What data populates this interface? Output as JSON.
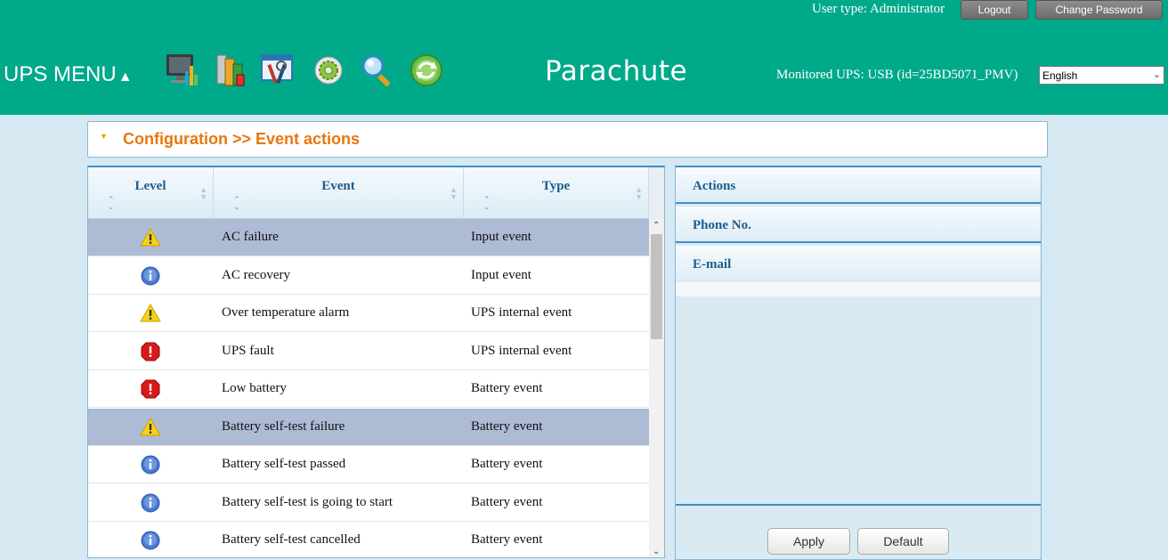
{
  "header": {
    "user_type": "User type: Administrator",
    "logout_label": "Logout",
    "change_password_label": "Change Password",
    "menu_label": "UPS MENU",
    "menu_caret": "▲",
    "brand": "Parachute",
    "monitored_ups": "Monitored UPS: USB (id=25BD5071_PMV)",
    "language": "English",
    "nav_icons": [
      "status-monitor-icon",
      "battery-data-icon",
      "configuration-tools-icon",
      "settings-gear-icon",
      "search-magnifier-icon",
      "refresh-icon"
    ]
  },
  "breadcrumb": {
    "title": "Configuration >> Event actions"
  },
  "table": {
    "columns": [
      "Level",
      "Event",
      "Type"
    ],
    "rows": [
      {
        "level": "warning",
        "event": "AC failure",
        "type": "Input event",
        "selected": true
      },
      {
        "level": "info",
        "event": "AC recovery",
        "type": "Input event",
        "selected": false
      },
      {
        "level": "warning",
        "event": "Over temperature alarm",
        "type": "UPS internal event",
        "selected": false
      },
      {
        "level": "error",
        "event": "UPS fault",
        "type": "UPS internal event",
        "selected": false
      },
      {
        "level": "error",
        "event": "Low battery",
        "type": "Battery event",
        "selected": false
      },
      {
        "level": "warning",
        "event": "Battery self-test failure",
        "type": "Battery event",
        "selected": true
      },
      {
        "level": "info",
        "event": "Battery self-test passed",
        "type": "Battery event",
        "selected": false
      },
      {
        "level": "info",
        "event": "Battery self-test is going to start",
        "type": "Battery event",
        "selected": false
      },
      {
        "level": "info",
        "event": "Battery self-test cancelled",
        "type": "Battery event",
        "selected": false
      }
    ]
  },
  "right_panel": {
    "sections": [
      "Actions",
      "Phone No.",
      "E-mail"
    ],
    "apply_label": "Apply",
    "default_label": "Default"
  },
  "colors": {
    "header_bg": "#00a98a",
    "page_bg": "#d6e9f2",
    "breadcrumb_text": "#e8760e",
    "selected_row": "#adbbd5",
    "column_header_text": "#1f5b8a"
  }
}
